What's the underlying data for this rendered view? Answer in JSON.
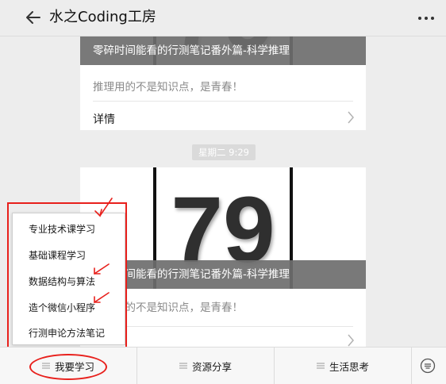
{
  "header": {
    "title": "水之Coding工房"
  },
  "articles": [
    {
      "cover_number": "79",
      "cover_caption": "零碎时间能看的行测笔记番外篇-科学推理",
      "summary": "推理用的不是知识点，是青春！",
      "detail_label": "详情"
    },
    {
      "cover_number": "79",
      "cover_caption": "零碎时间能看的行测笔记番外篇-科学推理",
      "summary": "推理用的不是知识点，是青春！"
    }
  ],
  "timestamp": "星期二 9:29",
  "menu": {
    "items": [
      "专业技术课学习",
      "基础课程学习",
      "数据结构与算法",
      "造个微信小程序",
      "行测申论方法笔记"
    ]
  },
  "bottom_tabs": [
    "我要学习",
    "资源分享",
    "生活思考"
  ],
  "colors": {
    "annotation": "#e8201c",
    "overlay": "#6e6e6e"
  },
  "icons": {
    "back": "back-arrow-icon",
    "more": "more-dots-icon",
    "chevron": "chevron-right-icon",
    "keyboard": "keyboard-icon",
    "menu": "hamburger-icon"
  }
}
